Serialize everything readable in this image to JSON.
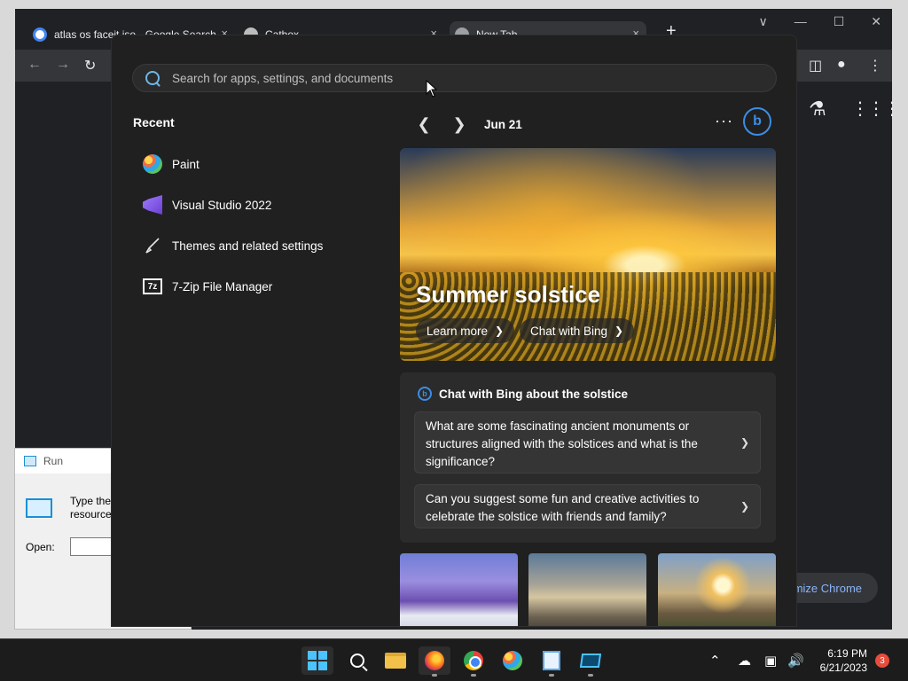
{
  "chrome": {
    "tabs": [
      {
        "title": "atlas os faceit iso - Google Search",
        "close": "×"
      },
      {
        "title": "Catbox",
        "close": "×"
      },
      {
        "title": "New Tab",
        "close": "×"
      }
    ],
    "new_tab": "+",
    "customize_label": "mize Chrome",
    "window_controls": [
      "∨",
      "—",
      "☐",
      "✕"
    ]
  },
  "run_dialog": {
    "title": "Run",
    "description_line1": "Type the",
    "description_line2": "resource",
    "open_label": "Open:"
  },
  "search": {
    "placeholder": "Search for apps, settings, and documents"
  },
  "recent": {
    "heading": "Recent",
    "items": [
      {
        "label": "Paint",
        "icon": "paint-icon"
      },
      {
        "label": "Visual Studio 2022",
        "icon": "visual-studio-icon"
      },
      {
        "label": "Themes and related settings",
        "icon": "brush-icon"
      },
      {
        "label": "7-Zip File Manager",
        "icon": "7zip-icon"
      }
    ]
  },
  "highlights": {
    "date": "Jun 21",
    "more": "···",
    "hero": {
      "title": "Summer solstice",
      "learn_more": "Learn more",
      "chat_with_bing": "Chat with Bing"
    },
    "chat_card": {
      "heading": "Chat with Bing about the solstice",
      "prompts": [
        "What are some fascinating ancient monuments or structures aligned with the solstices and what is the significance?",
        "Can you suggest some fun and creative activities to celebrate the solstice with friends and family?"
      ]
    }
  },
  "taskbar": {
    "apps": [
      "start",
      "search",
      "file-explorer",
      "firefox",
      "chrome",
      "paint",
      "notepad",
      "run"
    ],
    "time": "6:19 PM",
    "date": "6/21/2023",
    "notification_count": "3"
  },
  "colors": {
    "panel_bg": "#202020",
    "card_bg": "#2b2b2b",
    "accent": "#4cc2ff",
    "bing_blue": "#3a8ee6"
  }
}
